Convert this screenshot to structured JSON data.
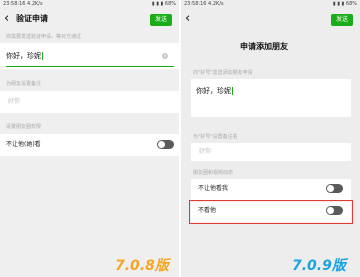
{
  "left": {
    "status_time": "23:58:16 4.2K/s",
    "status_right": "▮ ▮ ▮ 68%",
    "nav_title": "验证申请",
    "send_label": "发送",
    "hint_send": "你需要发送验证申请，等对方通过",
    "input_value": "你好，珍妮",
    "hint_remark": "为朋友设置备注",
    "remark_placeholder": "好你",
    "hint_privacy": "设置朋友圈权限",
    "privacy_row_label": "不让他(她)看",
    "version_label": "7.0.8版"
  },
  "right": {
    "status_time": "23:58:16 4.2K/s",
    "status_right": "▮ ▮ ▮ 68%",
    "send_label": "发送",
    "title": "申请添加朋友",
    "hint_send": "向\"好号\"发送添加朋友申请",
    "input_value": "你好，珍妮",
    "hint_remark": "为\"好号\"设置备注名",
    "remark_placeholder": "好你",
    "hint_privacy": "朋友圈和视频动态",
    "row1_label": "不让他看我",
    "row2_label": "不看他",
    "version_label": "7.0.9版"
  },
  "colors": {
    "accent_green": "#1aad19",
    "highlight_red": "#e53935",
    "version_orange": "#f5a623",
    "version_blue": "#1aa3e0"
  }
}
